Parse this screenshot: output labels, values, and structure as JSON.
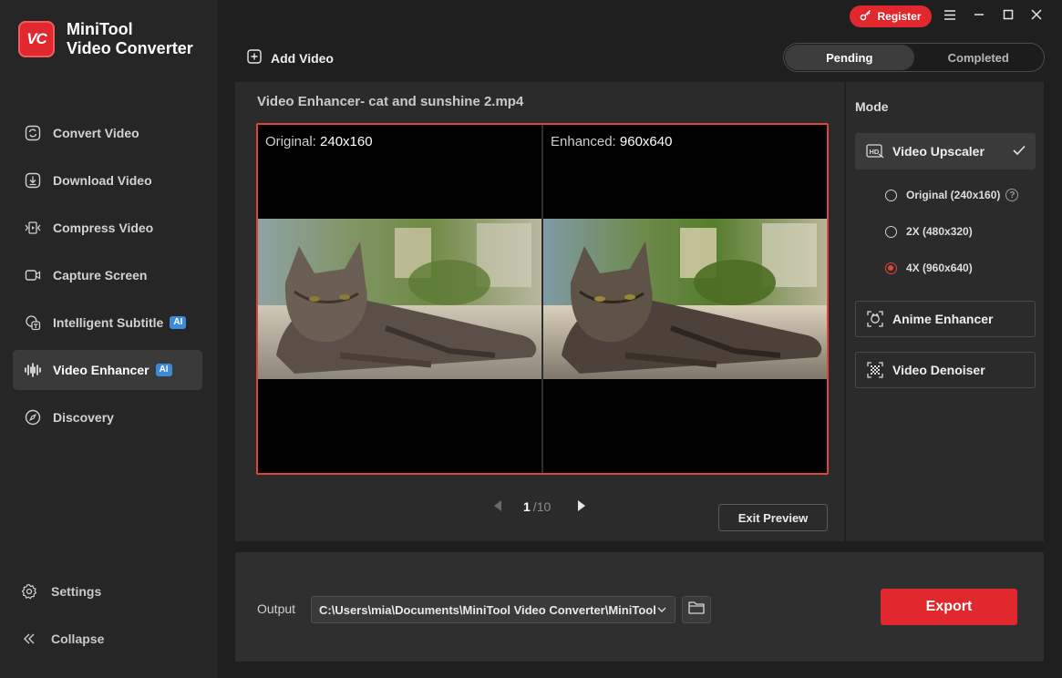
{
  "app": {
    "name_line1": "MiniTool",
    "name_line2": "Video Converter",
    "logo_text": "VC",
    "accent_color": "#e0282e"
  },
  "titlebar": {
    "register_label": "Register",
    "menu_icon": "hamburger-icon",
    "minimize_icon": "minimize-icon",
    "maximize_icon": "maximize-icon",
    "close_icon": "close-icon"
  },
  "sidebar": {
    "items": [
      {
        "label": "Convert Video",
        "icon": "convert-icon",
        "active": false
      },
      {
        "label": "Download Video",
        "icon": "download-icon",
        "active": false
      },
      {
        "label": "Compress Video",
        "icon": "compress-icon",
        "active": false
      },
      {
        "label": "Capture Screen",
        "icon": "camera-icon",
        "active": false
      },
      {
        "label": "Intelligent Subtitle",
        "icon": "subtitle-icon",
        "badge": "AI",
        "active": false
      },
      {
        "label": "Video Enhancer",
        "icon": "waveform-icon",
        "badge": "AI",
        "active": true
      },
      {
        "label": "Discovery",
        "icon": "compass-icon",
        "active": false
      }
    ],
    "settings_label": "Settings",
    "collapse_label": "Collapse"
  },
  "toolbar": {
    "add_video_label": "Add Video",
    "tabs": [
      {
        "label": "Pending",
        "active": true
      },
      {
        "label": "Completed",
        "active": false
      }
    ]
  },
  "main": {
    "title": "Video Enhancer- cat and sunshine 2.mp4",
    "original_prefix": "Original: ",
    "original_res": "240x160",
    "enhanced_prefix": "Enhanced: ",
    "enhanced_res": "960x640",
    "pager": {
      "current": "1",
      "separator": "/",
      "total": "10"
    },
    "exit_preview_label": "Exit Preview"
  },
  "mode": {
    "title": "Mode",
    "upscaler_label": "Video Upscaler",
    "options": [
      {
        "label": "Original (240x160)",
        "selected": false
      },
      {
        "label": "2X (480x320)",
        "selected": false
      },
      {
        "label": "4X (960x640)",
        "selected": true
      }
    ],
    "anime_label": "Anime Enhancer",
    "denoiser_label": "Video Denoiser",
    "help_glyph": "?"
  },
  "output": {
    "label": "Output",
    "path": "C:\\Users\\mia\\Documents\\MiniTool Video Converter\\MiniTool",
    "export_label": "Export"
  }
}
